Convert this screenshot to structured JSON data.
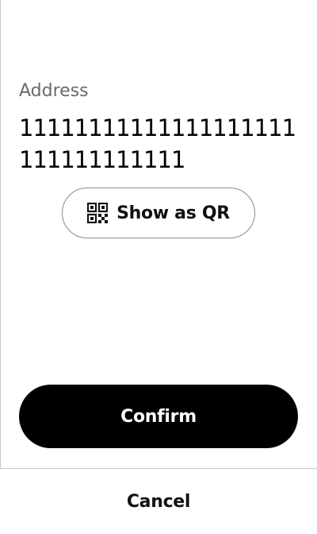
{
  "address": {
    "label": "Address",
    "value": "11111111111111111111111111111111"
  },
  "qr_button": {
    "label": "Show as QR",
    "icon": "qr-code-icon"
  },
  "actions": {
    "confirm_label": "Confirm",
    "cancel_label": "Cancel"
  },
  "colors": {
    "primary_button_bg": "#000000",
    "primary_button_text": "#ffffff",
    "label_text": "#6a6a6a",
    "outline": "#8a8a8a",
    "divider": "#c8c8c8"
  }
}
